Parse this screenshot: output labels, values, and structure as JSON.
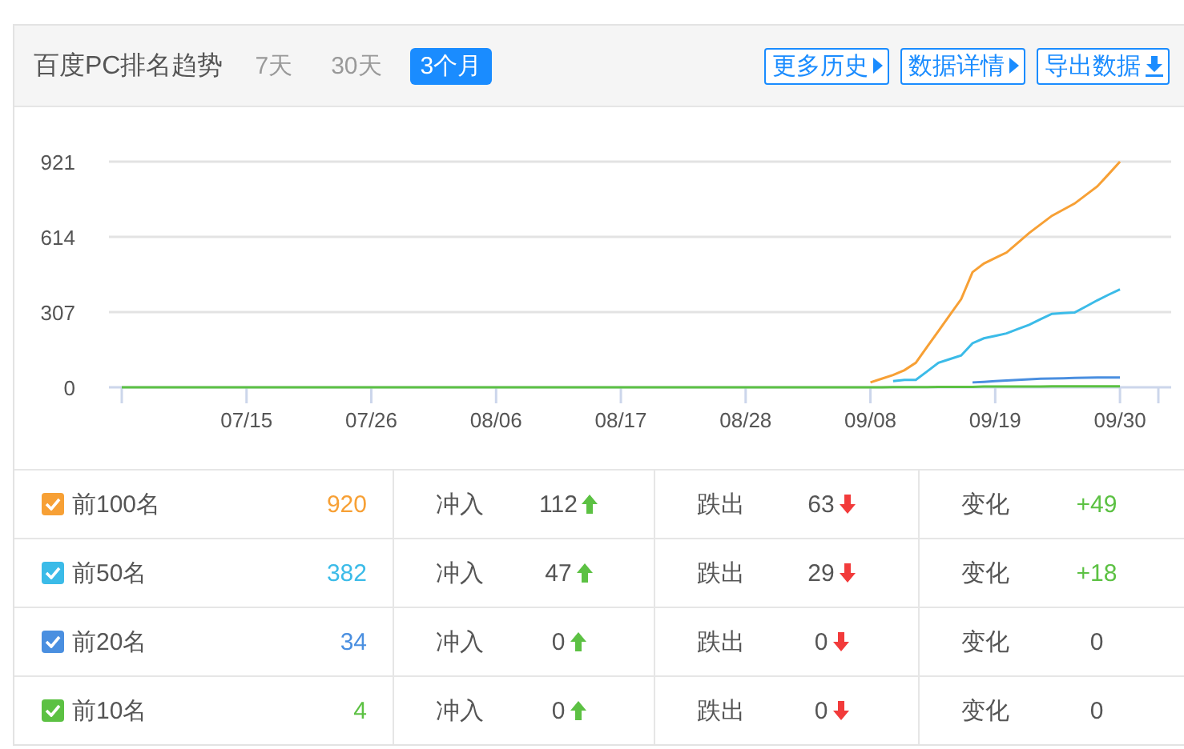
{
  "header": {
    "title": "百度PC排名趋势",
    "ranges": [
      {
        "label": "7天",
        "selected": false
      },
      {
        "label": "30天",
        "selected": false
      },
      {
        "label": "3个月",
        "selected": true
      }
    ],
    "actions": [
      {
        "label": "更多历史",
        "kind": "more"
      },
      {
        "label": "数据详情",
        "kind": "more"
      },
      {
        "label": "导出数据",
        "kind": "download"
      }
    ]
  },
  "chart": {
    "chart_data": {
      "type": "line",
      "ylim": [
        0,
        921
      ],
      "yticks": [
        0,
        307,
        614,
        921
      ],
      "categories": [
        null,
        null,
        null,
        null,
        null,
        null,
        null,
        null,
        null,
        null,
        null,
        "07/15",
        null,
        null,
        null,
        null,
        null,
        null,
        null,
        null,
        null,
        null,
        "07/26",
        null,
        null,
        null,
        null,
        null,
        null,
        null,
        null,
        null,
        null,
        "08/06",
        null,
        null,
        null,
        null,
        null,
        null,
        null,
        null,
        null,
        null,
        "08/17",
        null,
        null,
        null,
        null,
        null,
        null,
        null,
        null,
        null,
        null,
        "08/28",
        null,
        null,
        null,
        null,
        null,
        null,
        null,
        null,
        null,
        null,
        "09/08",
        null,
        null,
        null,
        null,
        null,
        null,
        null,
        null,
        null,
        null,
        "09/19",
        null,
        null,
        null,
        null,
        null,
        null,
        null,
        null,
        null,
        null,
        "09/30"
      ],
      "series": [
        {
          "color": "#f7a035",
          "values": [
            null,
            null,
            null,
            null,
            null,
            null,
            null,
            null,
            null,
            null,
            null,
            null,
            null,
            null,
            null,
            null,
            null,
            null,
            null,
            null,
            null,
            null,
            null,
            null,
            null,
            null,
            null,
            null,
            null,
            null,
            null,
            null,
            null,
            null,
            null,
            null,
            null,
            null,
            null,
            null,
            null,
            null,
            null,
            null,
            null,
            null,
            null,
            null,
            null,
            null,
            null,
            null,
            null,
            null,
            null,
            null,
            null,
            null,
            null,
            null,
            null,
            null,
            null,
            null,
            null,
            null,
            20,
            35,
            50,
            70,
            100,
            165,
            230,
            295,
            360,
            470,
            505,
            528,
            550,
            590,
            630,
            665,
            700,
            725,
            750,
            785,
            820,
            870,
            921
          ]
        },
        {
          "color": "#3bbbe8",
          "values": [
            null,
            null,
            null,
            null,
            null,
            null,
            null,
            null,
            null,
            null,
            null,
            null,
            null,
            null,
            null,
            null,
            null,
            null,
            null,
            null,
            null,
            null,
            null,
            null,
            null,
            null,
            null,
            null,
            null,
            null,
            null,
            null,
            null,
            null,
            null,
            null,
            null,
            null,
            null,
            null,
            null,
            null,
            null,
            null,
            null,
            null,
            null,
            null,
            null,
            null,
            null,
            null,
            null,
            null,
            null,
            null,
            null,
            null,
            null,
            null,
            null,
            null,
            null,
            null,
            null,
            null,
            null,
            null,
            25,
            30,
            30,
            65,
            100,
            115,
            130,
            180,
            200,
            210,
            220,
            238,
            255,
            278,
            300,
            303,
            305,
            330,
            355,
            378,
            400
          ]
        },
        {
          "color": "#4a8fe0",
          "values": [
            null,
            null,
            null,
            null,
            null,
            null,
            null,
            null,
            null,
            null,
            null,
            null,
            null,
            null,
            null,
            null,
            null,
            null,
            null,
            null,
            null,
            null,
            null,
            null,
            null,
            null,
            null,
            null,
            null,
            null,
            null,
            null,
            null,
            null,
            null,
            null,
            null,
            null,
            null,
            null,
            null,
            null,
            null,
            null,
            null,
            null,
            null,
            null,
            null,
            null,
            null,
            null,
            null,
            null,
            null,
            null,
            null,
            null,
            null,
            null,
            null,
            null,
            null,
            null,
            null,
            null,
            null,
            null,
            null,
            null,
            null,
            null,
            null,
            null,
            null,
            20,
            22,
            25,
            28,
            30,
            33,
            35,
            36,
            37,
            38,
            39,
            40,
            40,
            40
          ]
        },
        {
          "color": "#5cc143",
          "values": [
            0,
            0,
            0,
            0,
            0,
            0,
            0,
            0,
            0,
            0,
            0,
            0,
            0,
            0,
            0,
            0,
            0,
            0,
            0,
            0,
            0,
            0,
            0,
            0,
            0,
            0,
            0,
            0,
            0,
            0,
            0,
            0,
            0,
            0,
            0,
            0,
            0,
            0,
            0,
            0,
            0,
            0,
            0,
            0,
            0,
            0,
            0,
            0,
            0,
            0,
            0,
            0,
            0,
            0,
            0,
            0,
            0,
            0,
            0,
            0,
            0,
            0,
            0,
            0,
            0,
            0,
            0,
            0,
            1,
            1,
            1,
            1,
            2,
            2,
            2,
            2,
            3,
            3,
            3,
            3,
            3,
            3,
            4,
            4,
            4,
            4,
            4,
            4,
            4
          ]
        }
      ]
    }
  },
  "rows": [
    {
      "label": "前100名",
      "checked": true,
      "color": "#f7a035",
      "total": "920",
      "rise_label": "冲入",
      "rise": "112",
      "fall_label": "跌出",
      "fall": "63",
      "change_label": "变化",
      "change": "+49",
      "change_positive": true
    },
    {
      "label": "前50名",
      "checked": true,
      "color": "#3bbbe8",
      "total": "382",
      "rise_label": "冲入",
      "rise": "47",
      "fall_label": "跌出",
      "fall": "29",
      "change_label": "变化",
      "change": "+18",
      "change_positive": true
    },
    {
      "label": "前20名",
      "checked": true,
      "color": "#4a8fe0",
      "total": "34",
      "rise_label": "冲入",
      "rise": "0",
      "fall_label": "跌出",
      "fall": "0",
      "change_label": "变化",
      "change": "0",
      "change_positive": false
    },
    {
      "label": "前10名",
      "checked": true,
      "color": "#5cc143",
      "total": "4",
      "rise_label": "冲入",
      "rise": "0",
      "fall_label": "跌出",
      "fall": "0",
      "change_label": "变化",
      "change": "0",
      "change_positive": false
    }
  ]
}
